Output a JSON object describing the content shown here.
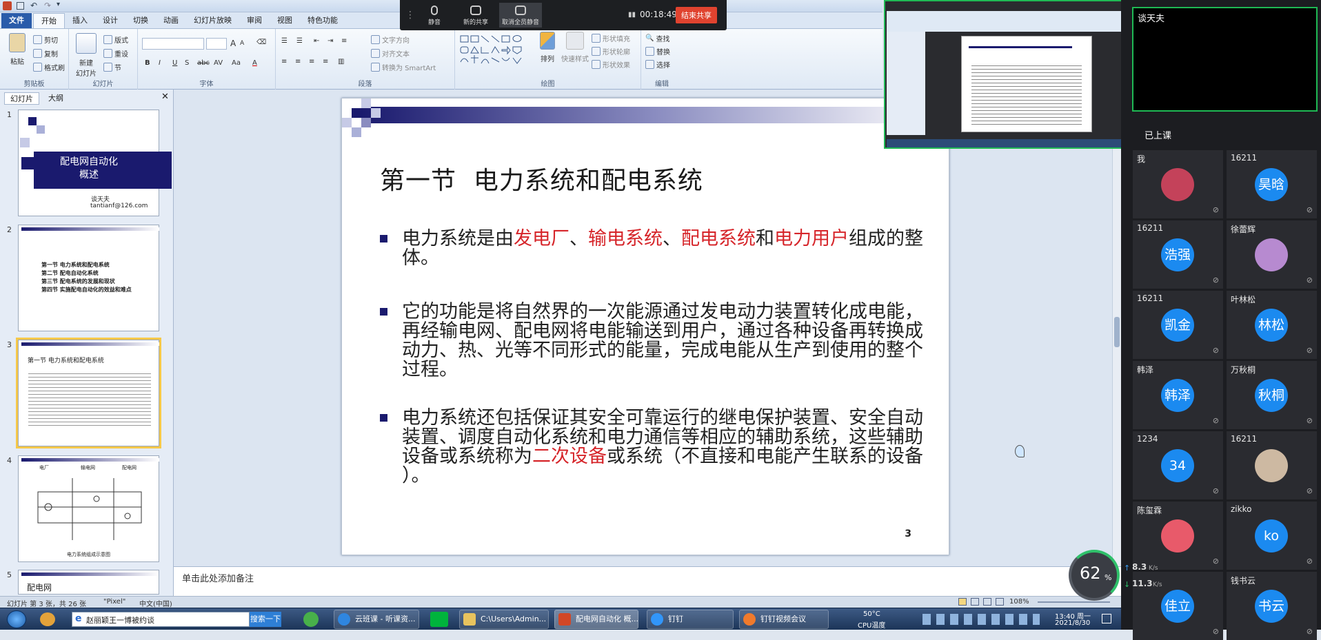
{
  "quick_access": {
    "icons": [
      "app-logo",
      "save",
      "undo",
      "redo",
      "customize"
    ]
  },
  "ribbon_tabs": [
    "文件",
    "开始",
    "插入",
    "设计",
    "切换",
    "动画",
    "幻灯片放映",
    "审阅",
    "视图",
    "特色功能"
  ],
  "ribbon": {
    "clipboard": {
      "paste": "粘贴",
      "cut": "剪切",
      "copy": "复制",
      "format_painter": "格式刷",
      "label": "剪贴板"
    },
    "slides": {
      "new_slide": "新建\n幻灯片",
      "layout": "版式",
      "reset": "重设",
      "section": "节",
      "label": "幻灯片"
    },
    "font": {
      "label": "字体",
      "bold": "B",
      "italic": "I",
      "underline": "U",
      "shadow": "S",
      "strike": "abc",
      "spacing": "AV",
      "case": "Aa",
      "color": "A",
      "grow": "A",
      "shrink": "A"
    },
    "paragraph": {
      "text_direction": "文字方向",
      "align_text": "对齐文本",
      "smartart": "转换为 SmartArt",
      "label": "段落"
    },
    "drawing": {
      "arrange": "排列",
      "quick_styles": "快速样式",
      "shape_fill": "形状填充",
      "shape_outline": "形状轮廓",
      "shape_effects": "形状效果",
      "label": "绘图"
    },
    "editing": {
      "find": "查找",
      "replace": "替换",
      "select": "选择",
      "label": "编辑"
    }
  },
  "panel_tabs": [
    "幻灯片",
    "大纲"
  ],
  "thumbnails": [
    {
      "num": "1",
      "title": "配电网自动化\n概述",
      "author": "谈天夫",
      "email": "tantianf@126.com",
      "page": "1"
    },
    {
      "num": "2",
      "items": [
        "第一节  电力系统和配电系统",
        "第二节  配电自动化系统",
        "第三节  配电系统的发展和现状",
        "第四节  实施配电自动化的效益和难点"
      ],
      "page": "2"
    },
    {
      "num": "3",
      "title": "第一节  电力系统和配电系统",
      "page": "3"
    },
    {
      "num": "4",
      "labels": [
        "电厂",
        "输电网",
        "配电网"
      ],
      "caption": "电力系统组成示意图",
      "page": "4"
    },
    {
      "num": "5",
      "title": "配电网"
    }
  ],
  "slide": {
    "title": "第一节  电力系统和配电系统",
    "bullet1": {
      "pre": "电力系统是由",
      "r1": "发电厂",
      "s1": "、",
      "r2": "输电系统",
      "s2": "、",
      "r3": "配电系统",
      "s3": "和",
      "r4": "电力用户",
      "post": "组成的整体。"
    },
    "bullet2": "它的功能是将自然界的一次能源通过发电动力装置转化成电能，再经输电网、配电网将电能输送到用户，通过各种设备再转换成动力、热、光等不同形式的能量，完成电能从生产到使用的整个过程。",
    "bullet3": {
      "pre": "电力系统还包括保证其安全可靠运行的继电保护装置、安全自动装置、调度自动化系统和电力通信等相应的辅助系统，这些辅助设备或系统称为",
      "red": "二次设备",
      "post": "或系统（不直接和电能产生联系的设备 ）。"
    },
    "page": "3"
  },
  "notes_placeholder": "单击此处添加备注",
  "statusbar": {
    "slide_info": "幻灯片 第 3 张，共 26 张",
    "theme": "\"Pixel\"",
    "language": "中文(中国)",
    "zoom": "108%"
  },
  "meeting_bar": {
    "mute": "静音",
    "new_share": "新的共享",
    "unmute_all": "取消全员静音",
    "timer": "00:18:49",
    "end_share": "结束共享"
  },
  "presenter": {
    "name": "谈天夫"
  },
  "attendance_label": "已上课",
  "participants": [
    {
      "name": "我",
      "avatar": "",
      "type": "photo"
    },
    {
      "name": "16211",
      "avatar": "昊晗",
      "type": "text"
    },
    {
      "name": "16211",
      "avatar": "浩强",
      "type": "text"
    },
    {
      "name": "徐蕾辉",
      "avatar": "",
      "type": "photo"
    },
    {
      "name": "16211",
      "avatar": "凯金",
      "type": "text"
    },
    {
      "name": "叶林松",
      "avatar": "林松",
      "type": "text"
    },
    {
      "name": "韩泽",
      "avatar": "韩泽",
      "type": "text"
    },
    {
      "name": "万秋桐",
      "avatar": "秋桐",
      "type": "text"
    },
    {
      "name": "1234",
      "avatar": "34",
      "type": "text"
    },
    {
      "name": "16211",
      "avatar": "",
      "type": "photo"
    },
    {
      "name": "陈玺霖",
      "avatar": "",
      "type": "photo"
    },
    {
      "name": "zikko",
      "avatar": "ko",
      "type": "text"
    },
    {
      "name": "",
      "avatar": "佳立",
      "type": "text"
    },
    {
      "name": "钱书云",
      "avatar": "书云",
      "type": "text"
    }
  ],
  "speed": {
    "percent": "62",
    "up": "8.3",
    "down": "11.3",
    "unit": "K/s"
  },
  "taskbar": {
    "search_text": "赵丽颖王一博被约谈",
    "search_btn": "搜索一下",
    "apps": [
      "云班课 - 听课资...",
      "C:\\Users\\Admin...",
      "配电网自动化 概...",
      "钉钉",
      "钉钉视频会议"
    ],
    "cpu_temp": "50°C",
    "cpu_label": "CPU温度",
    "time": "13:40 周一",
    "date": "2021/8/30"
  },
  "colors": {
    "accent_red": "#d6252a",
    "slide_blue": "#1a1a6e",
    "ribbon_bg": "#dfe9f5",
    "end_button": "#e0432f"
  }
}
